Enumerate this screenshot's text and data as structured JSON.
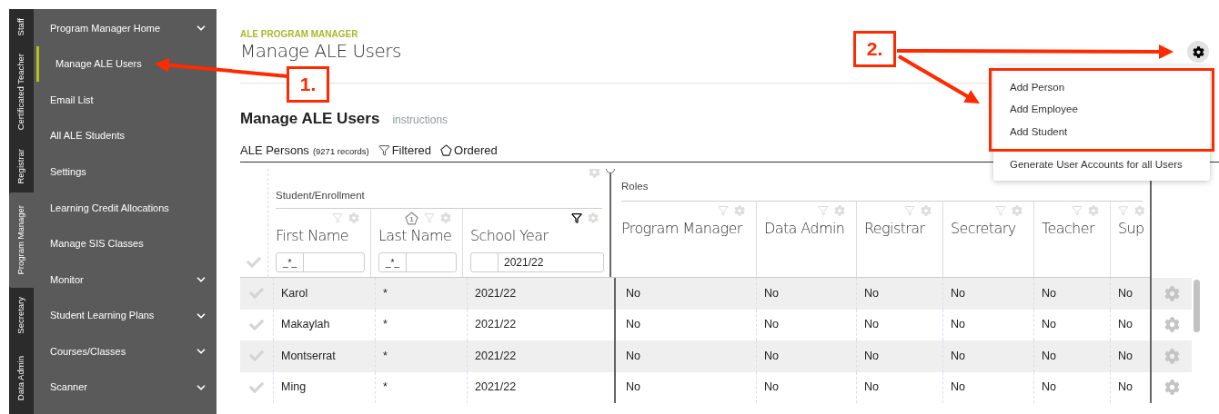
{
  "vertical_tabs": [
    {
      "label": "Staff",
      "selected": false
    },
    {
      "label": "Certificated Teacher",
      "selected": false
    },
    {
      "label": "Registrar",
      "selected": false
    },
    {
      "label": "Program Manager",
      "selected": true
    },
    {
      "label": "Secretary",
      "selected": false
    },
    {
      "label": "Data Admin",
      "selected": false
    }
  ],
  "menu": [
    {
      "label": "Program Manager Home",
      "selected": false,
      "expandable": true
    },
    {
      "label": "Manage ALE Users",
      "selected": true,
      "expandable": false
    },
    {
      "label": "Email List",
      "selected": false,
      "expandable": false
    },
    {
      "label": "All ALE Students",
      "selected": false,
      "expandable": false
    },
    {
      "label": "Settings",
      "selected": false,
      "expandable": false
    },
    {
      "label": "Learning Credit Allocations",
      "selected": false,
      "expandable": false
    },
    {
      "label": "Manage SIS Classes",
      "selected": false,
      "expandable": false
    },
    {
      "label": "Monitor",
      "selected": false,
      "expandable": true
    },
    {
      "label": "Student Learning Plans",
      "selected": false,
      "expandable": true
    },
    {
      "label": "Courses/Classes",
      "selected": false,
      "expandable": true
    },
    {
      "label": "Scanner",
      "selected": false,
      "expandable": true
    }
  ],
  "header": {
    "eyebrow": "ALE PROGRAM MANAGER",
    "title": "Manage ALE Users"
  },
  "section": {
    "title": "Manage ALE Users",
    "link": "instructions"
  },
  "toolbar": {
    "label": "ALE Persons",
    "count": "(9271 records)",
    "filtered": "Filtered",
    "ordered": "Ordered"
  },
  "table": {
    "groups": [
      {
        "label": "Student/Enrollment",
        "columns": [
          {
            "label": "First Name",
            "filtered": false,
            "operator": "_*_"
          },
          {
            "label": "Last Name",
            "filtered": false,
            "sort_order": "1",
            "operator": "_*_"
          },
          {
            "label": "School Year",
            "filtered": true,
            "value": "2021/22"
          }
        ]
      },
      {
        "label": "Roles",
        "columns": [
          {
            "label": "Program Manager",
            "filtered": false
          },
          {
            "label": "Data Admin",
            "filtered": false
          },
          {
            "label": "Registrar",
            "filtered": false
          },
          {
            "label": "Secretary",
            "filtered": false
          },
          {
            "label": "Teacher",
            "filtered": false
          },
          {
            "label": "Sup",
            "filtered": false
          }
        ]
      }
    ],
    "rows": [
      {
        "checked": false,
        "cells": [
          "Karol",
          "*",
          "2021/22",
          "No",
          "No",
          "No",
          "No",
          "No",
          "No"
        ]
      },
      {
        "checked": false,
        "cells": [
          "Makaylah",
          "*",
          "2021/22",
          "No",
          "No",
          "No",
          "No",
          "No",
          "No"
        ]
      },
      {
        "checked": false,
        "cells": [
          "Montserrat",
          "*",
          "2021/22",
          "No",
          "No",
          "No",
          "No",
          "No",
          "No"
        ]
      },
      {
        "checked": false,
        "cells": [
          "Ming",
          "*",
          "2021/22",
          "No",
          "No",
          "No",
          "No",
          "No",
          "No"
        ]
      }
    ]
  },
  "settings_menu": {
    "open": true,
    "items": [
      {
        "label": "Add Person",
        "highlighted": true
      },
      {
        "label": "Add Employee",
        "highlighted": true
      },
      {
        "label": "Add Student",
        "highlighted": true
      },
      {
        "label": "Generate User Accounts for all Users",
        "highlighted": false
      }
    ]
  },
  "annotations": [
    {
      "label": "1."
    },
    {
      "label": "2."
    }
  ]
}
